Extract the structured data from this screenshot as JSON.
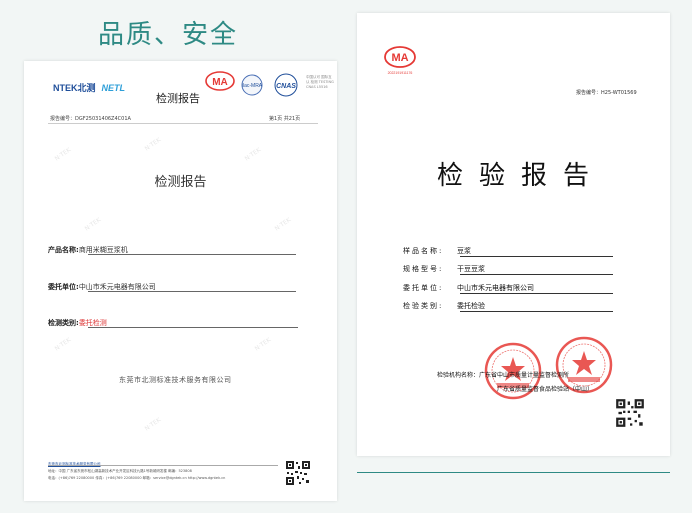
{
  "heading": "品质、安全",
  "left_report": {
    "brand_ntek": "NTEK北测",
    "brand_netl": "NETL",
    "header_title": "检测报告",
    "ma_mark": "MA",
    "ilac_mark": "ilac-MRA",
    "cnas_mark": "CNAS",
    "cnas_note": "中国认可 国际互认 检测 TESTING CNAS L5516",
    "report_no": "报告编号：DGF25031406Z4C01A",
    "page_info": "第1页 共21页",
    "title": "检测报告",
    "fields": [
      {
        "label": "产品名称:",
        "value": "商用米糊豆浆机"
      },
      {
        "label": "委托单位:",
        "value": "中山市禾元电器有限公司"
      },
      {
        "label": "检测类别:",
        "value": "委托检测"
      }
    ],
    "org": "东莞市北测标准技术服务有限公司",
    "footer": [
      "东莞市北测标准技术服务有限公司",
      "地址：中国 广东省东莞市松山湖高新技术产业开发区科技九路1号新城研发楼 邮编：523808",
      "电话：(+86)769 22080000    传真：(+86)769 22080000    邮箱：service@dgntek.cn    http://www.dgntek.cn"
    ]
  },
  "right_report": {
    "ma_mark": "MA",
    "ma_number": "2022191911176",
    "report_no": "报告编号：H25-WT01569",
    "title": "检验报告",
    "fields": [
      {
        "label": "样品名称:",
        "value": "豆浆"
      },
      {
        "label": "规格型号:",
        "value": "干豆豆浆"
      },
      {
        "label": "委托单位:",
        "value": "中山市禾元电器有限公司"
      },
      {
        "label": "检验类别:",
        "value": "委托检验"
      }
    ],
    "sign_label": "检验机构名称：",
    "sign_line1": "广东省中山市质量计量监督检测所",
    "sign_line2": "广东省质量监督食品检验站（中山）"
  },
  "colors": {
    "accent": "#2e8a84",
    "seal": "#e53935",
    "brand_blue": "#1f4e9a"
  }
}
